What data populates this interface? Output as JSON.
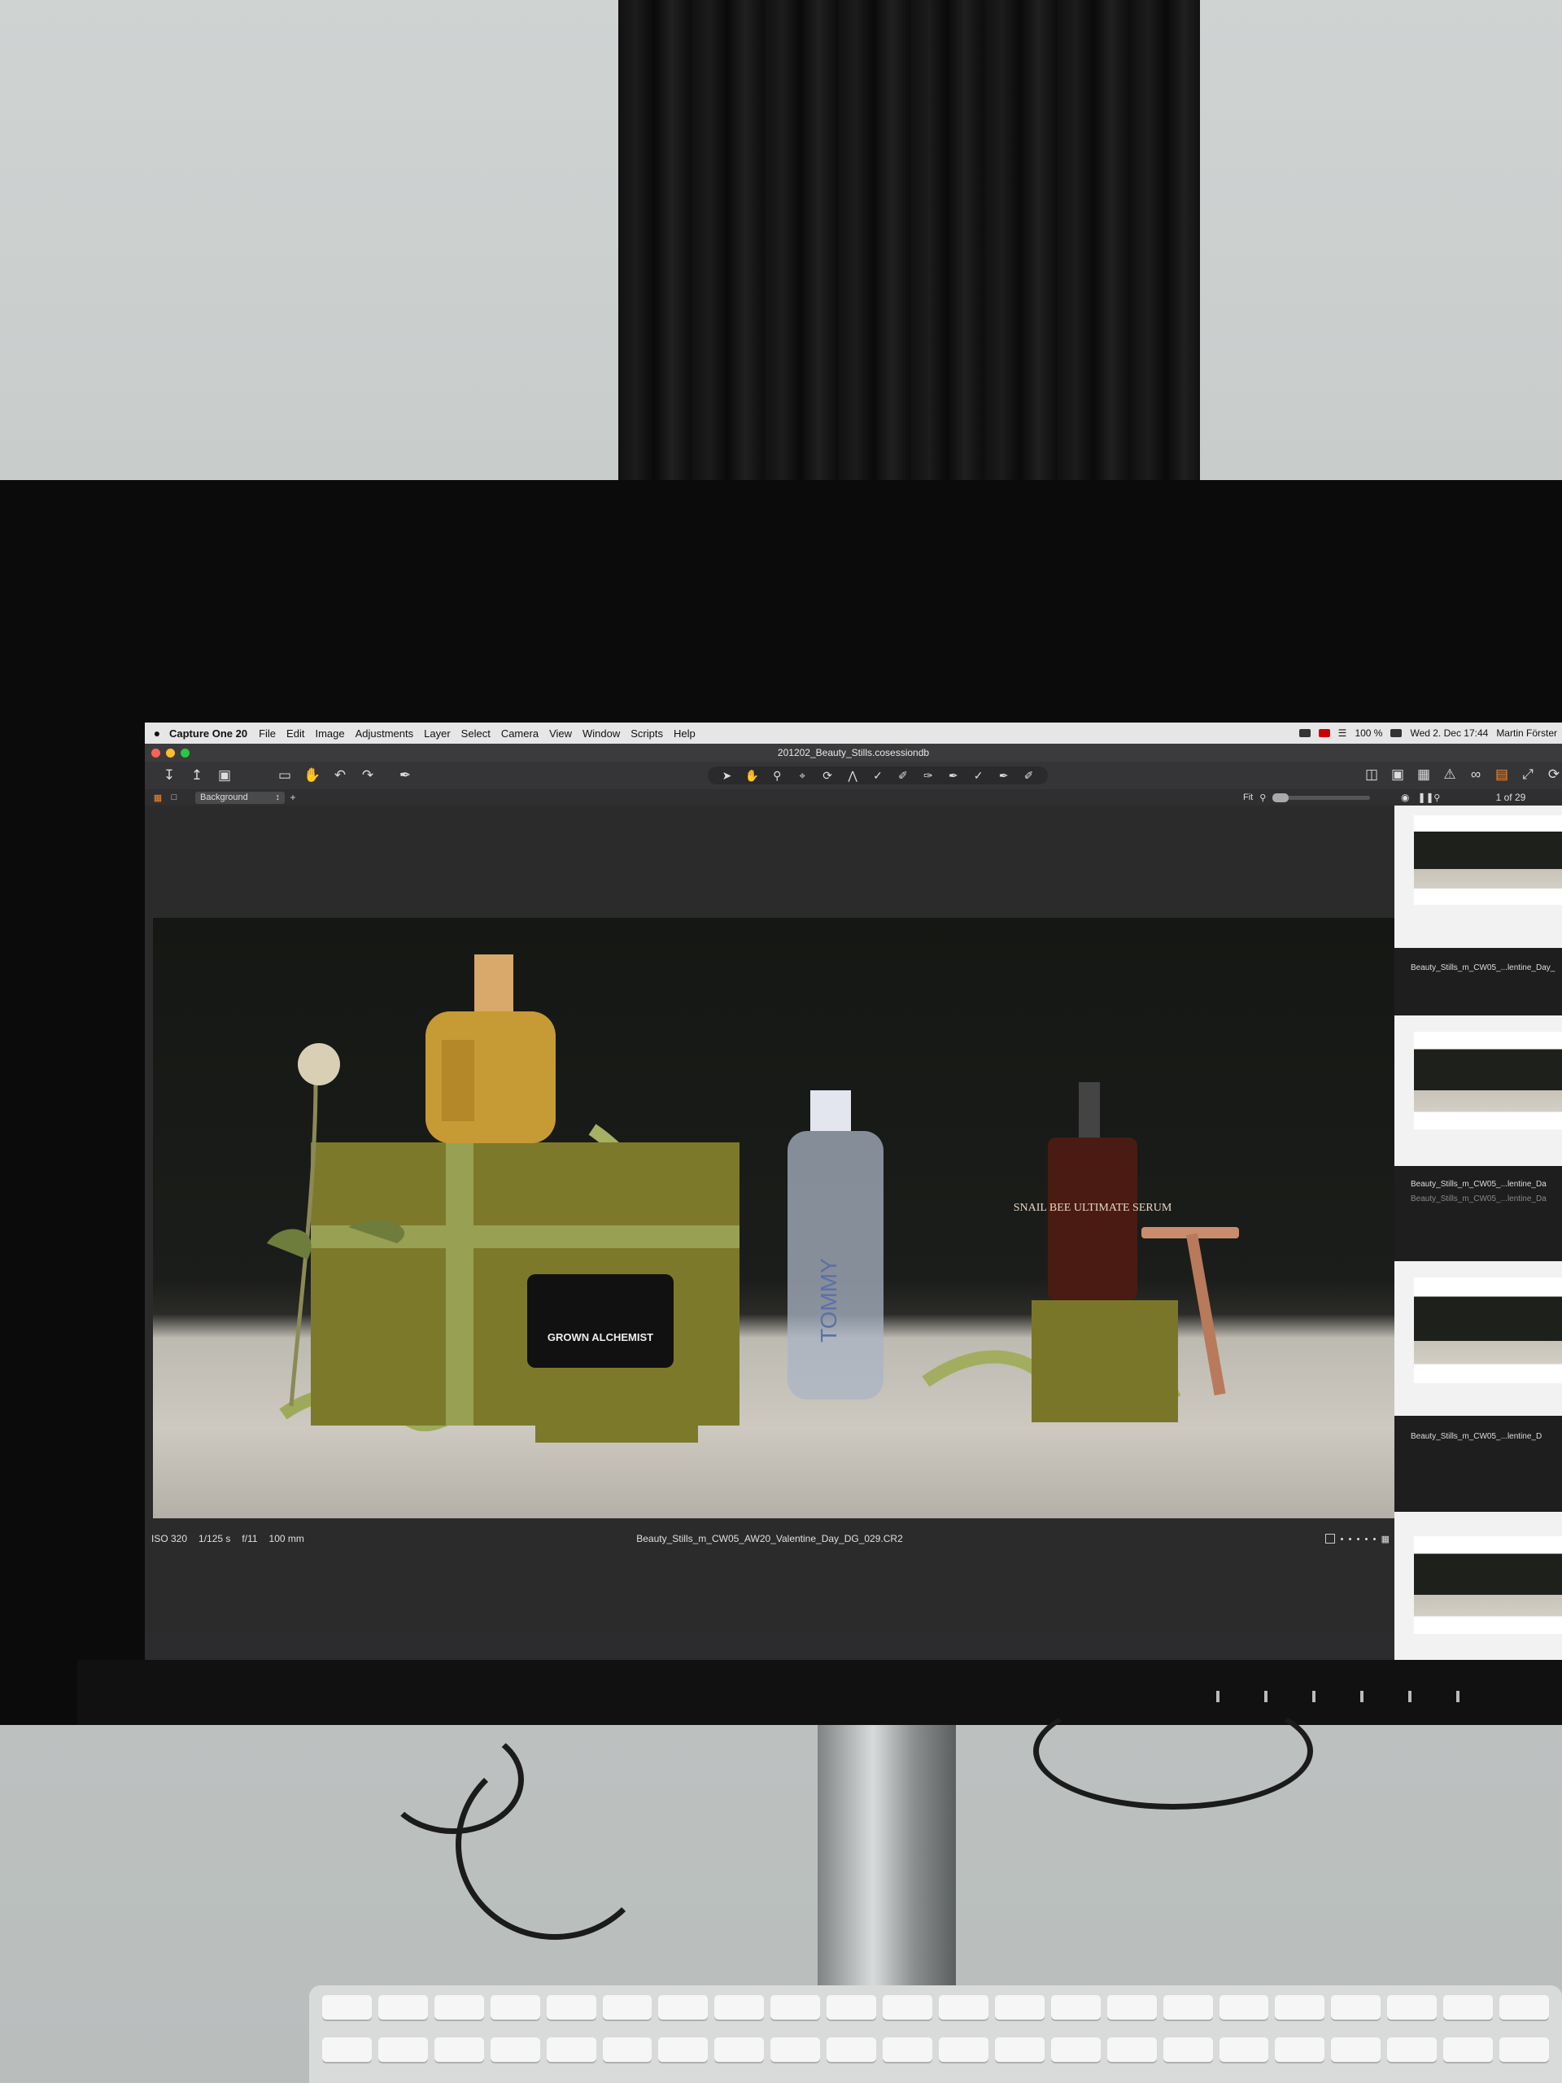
{
  "menubar": {
    "apple": "",
    "app_name": "Capture One 20",
    "items": [
      "File",
      "Edit",
      "Image",
      "Adjustments",
      "Layer",
      "Select",
      "Camera",
      "View",
      "Window",
      "Scripts",
      "Help"
    ],
    "battery": "100 %",
    "datetime": "Wed 2. Dec  17:44",
    "user": "Martin Förster"
  },
  "window": {
    "document_title": "201202_Beauty_Stills.cosessiondb",
    "traffic_colors": [
      "#fe5f57",
      "#febc2e",
      "#28c840"
    ]
  },
  "toolbar": {
    "left_icons": [
      "import-icon",
      "export-icon",
      "camera-icon",
      "battery-icon",
      "hand-icon",
      "undo-icon",
      "redo-icon",
      "brush-icon"
    ],
    "center_icons": [
      "cursor-icon",
      "pan-icon",
      "zoom-icon",
      "crop-icon",
      "rotate-icon",
      "keystone-icon",
      "spot-icon",
      "brush-icon",
      "eraser-icon",
      "gradient-icon",
      "radial-icon",
      "picker-icon",
      "pen-icon"
    ],
    "right_icons": [
      "compare-icon",
      "proof-icon",
      "grid-icon",
      "warning-icon",
      "glasses-icon",
      "layers-icon",
      "expand-icon",
      "rotate-right-icon"
    ]
  },
  "subbar": {
    "layer": "Background",
    "zoom_label": "Fit"
  },
  "filmstrip": {
    "counter": "1 of 29",
    "labels": [
      "Beauty_Stills_m_CW05_...lentine_Day_",
      "Beauty_Stills_m_CW05_...lentine_Da",
      "Beauty_Stills_m_CW05_...lentine_Da",
      "Beauty_Stills_m_CW05_...lentine_D"
    ]
  },
  "status": {
    "iso": "ISO 320",
    "shutter": "1/125 s",
    "aperture": "f/11",
    "focal": "100 mm",
    "filename": "Beauty_Stills_m_CW05_AW20_Valentine_Day_DG_029.CR2"
  },
  "photo": {
    "jar_text": "GROWN ALCHEMIST",
    "serum_text": "SNAIL BEE ULTIMATE SERUM",
    "bottle_text": "TOMMY"
  }
}
